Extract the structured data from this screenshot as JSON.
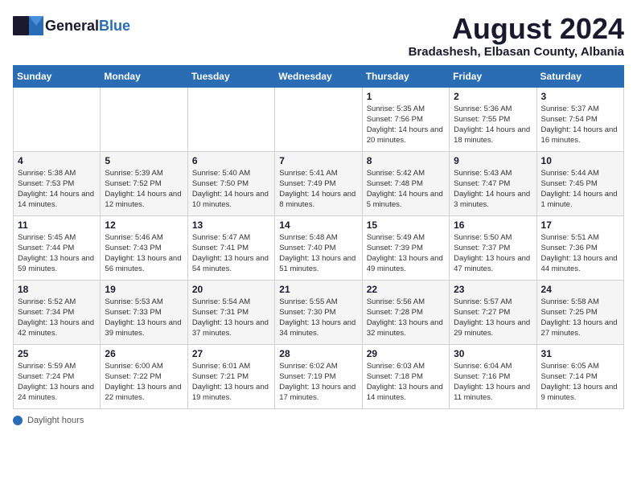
{
  "header": {
    "logo_general": "General",
    "logo_blue": "Blue",
    "month_year": "August 2024",
    "location": "Bradashesh, Elbasan County, Albania"
  },
  "days_of_week": [
    "Sunday",
    "Monday",
    "Tuesday",
    "Wednesday",
    "Thursday",
    "Friday",
    "Saturday"
  ],
  "weeks": [
    [
      {
        "day": "",
        "text": ""
      },
      {
        "day": "",
        "text": ""
      },
      {
        "day": "",
        "text": ""
      },
      {
        "day": "",
        "text": ""
      },
      {
        "day": "1",
        "text": "Sunrise: 5:35 AM\nSunset: 7:56 PM\nDaylight: 14 hours and 20 minutes."
      },
      {
        "day": "2",
        "text": "Sunrise: 5:36 AM\nSunset: 7:55 PM\nDaylight: 14 hours and 18 minutes."
      },
      {
        "day": "3",
        "text": "Sunrise: 5:37 AM\nSunset: 7:54 PM\nDaylight: 14 hours and 16 minutes."
      }
    ],
    [
      {
        "day": "4",
        "text": "Sunrise: 5:38 AM\nSunset: 7:53 PM\nDaylight: 14 hours and 14 minutes."
      },
      {
        "day": "5",
        "text": "Sunrise: 5:39 AM\nSunset: 7:52 PM\nDaylight: 14 hours and 12 minutes."
      },
      {
        "day": "6",
        "text": "Sunrise: 5:40 AM\nSunset: 7:50 PM\nDaylight: 14 hours and 10 minutes."
      },
      {
        "day": "7",
        "text": "Sunrise: 5:41 AM\nSunset: 7:49 PM\nDaylight: 14 hours and 8 minutes."
      },
      {
        "day": "8",
        "text": "Sunrise: 5:42 AM\nSunset: 7:48 PM\nDaylight: 14 hours and 5 minutes."
      },
      {
        "day": "9",
        "text": "Sunrise: 5:43 AM\nSunset: 7:47 PM\nDaylight: 14 hours and 3 minutes."
      },
      {
        "day": "10",
        "text": "Sunrise: 5:44 AM\nSunset: 7:45 PM\nDaylight: 14 hours and 1 minute."
      }
    ],
    [
      {
        "day": "11",
        "text": "Sunrise: 5:45 AM\nSunset: 7:44 PM\nDaylight: 13 hours and 59 minutes."
      },
      {
        "day": "12",
        "text": "Sunrise: 5:46 AM\nSunset: 7:43 PM\nDaylight: 13 hours and 56 minutes."
      },
      {
        "day": "13",
        "text": "Sunrise: 5:47 AM\nSunset: 7:41 PM\nDaylight: 13 hours and 54 minutes."
      },
      {
        "day": "14",
        "text": "Sunrise: 5:48 AM\nSunset: 7:40 PM\nDaylight: 13 hours and 51 minutes."
      },
      {
        "day": "15",
        "text": "Sunrise: 5:49 AM\nSunset: 7:39 PM\nDaylight: 13 hours and 49 minutes."
      },
      {
        "day": "16",
        "text": "Sunrise: 5:50 AM\nSunset: 7:37 PM\nDaylight: 13 hours and 47 minutes."
      },
      {
        "day": "17",
        "text": "Sunrise: 5:51 AM\nSunset: 7:36 PM\nDaylight: 13 hours and 44 minutes."
      }
    ],
    [
      {
        "day": "18",
        "text": "Sunrise: 5:52 AM\nSunset: 7:34 PM\nDaylight: 13 hours and 42 minutes."
      },
      {
        "day": "19",
        "text": "Sunrise: 5:53 AM\nSunset: 7:33 PM\nDaylight: 13 hours and 39 minutes."
      },
      {
        "day": "20",
        "text": "Sunrise: 5:54 AM\nSunset: 7:31 PM\nDaylight: 13 hours and 37 minutes."
      },
      {
        "day": "21",
        "text": "Sunrise: 5:55 AM\nSunset: 7:30 PM\nDaylight: 13 hours and 34 minutes."
      },
      {
        "day": "22",
        "text": "Sunrise: 5:56 AM\nSunset: 7:28 PM\nDaylight: 13 hours and 32 minutes."
      },
      {
        "day": "23",
        "text": "Sunrise: 5:57 AM\nSunset: 7:27 PM\nDaylight: 13 hours and 29 minutes."
      },
      {
        "day": "24",
        "text": "Sunrise: 5:58 AM\nSunset: 7:25 PM\nDaylight: 13 hours and 27 minutes."
      }
    ],
    [
      {
        "day": "25",
        "text": "Sunrise: 5:59 AM\nSunset: 7:24 PM\nDaylight: 13 hours and 24 minutes."
      },
      {
        "day": "26",
        "text": "Sunrise: 6:00 AM\nSunset: 7:22 PM\nDaylight: 13 hours and 22 minutes."
      },
      {
        "day": "27",
        "text": "Sunrise: 6:01 AM\nSunset: 7:21 PM\nDaylight: 13 hours and 19 minutes."
      },
      {
        "day": "28",
        "text": "Sunrise: 6:02 AM\nSunset: 7:19 PM\nDaylight: 13 hours and 17 minutes."
      },
      {
        "day": "29",
        "text": "Sunrise: 6:03 AM\nSunset: 7:18 PM\nDaylight: 13 hours and 14 minutes."
      },
      {
        "day": "30",
        "text": "Sunrise: 6:04 AM\nSunset: 7:16 PM\nDaylight: 13 hours and 11 minutes."
      },
      {
        "day": "31",
        "text": "Sunrise: 6:05 AM\nSunset: 7:14 PM\nDaylight: 13 hours and 9 minutes."
      }
    ]
  ],
  "legend": {
    "label": "Daylight hours"
  }
}
